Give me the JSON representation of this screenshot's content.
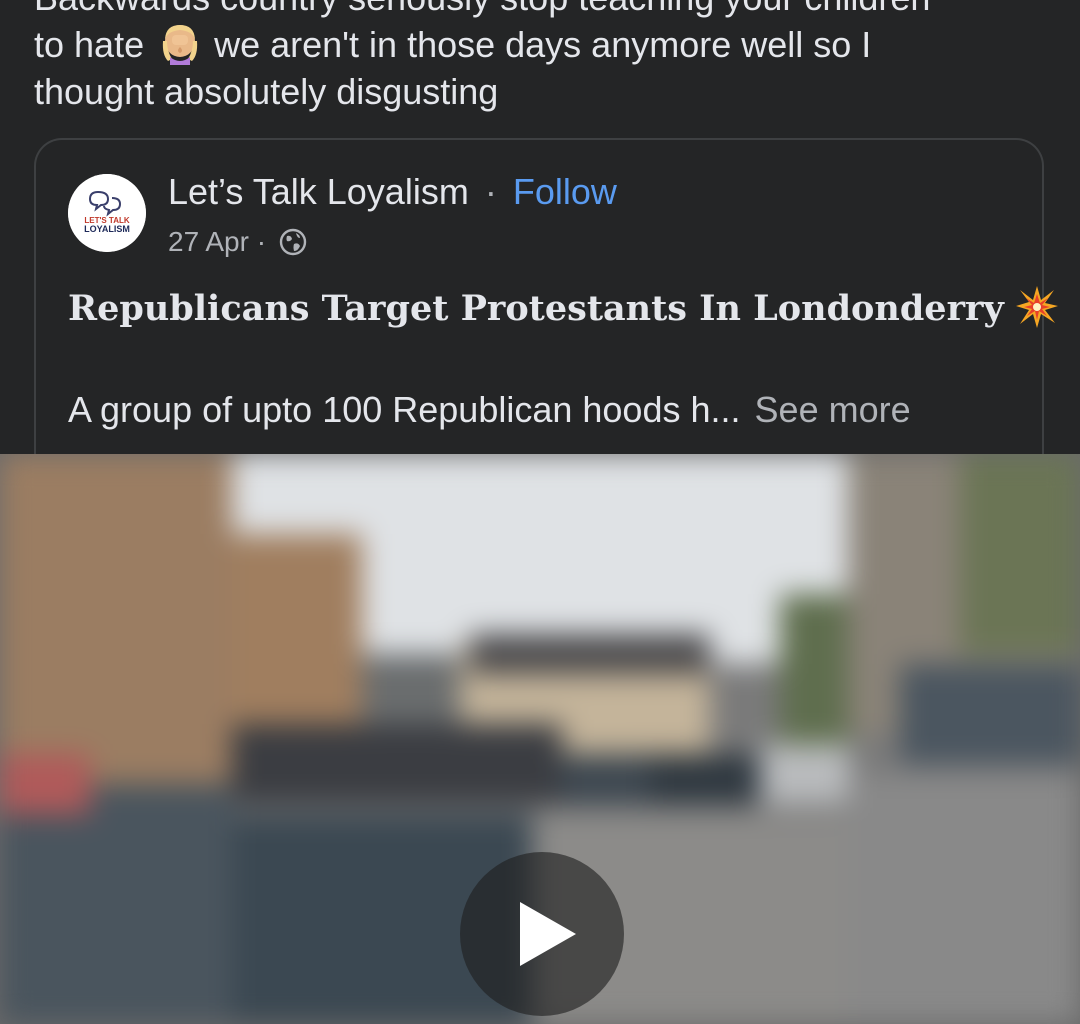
{
  "post": {
    "text_line1": "Backwards country seriously stop teaching your children",
    "text_line2_a": "to hate",
    "text_line2_b": "we aren't in those days anymore well so I",
    "text_line3": "thought absolutely disgusting",
    "emoji": "facepalm-emoji"
  },
  "shared_post": {
    "page_name": "Let’s Talk Loyalism",
    "separator": "·",
    "follow_label": "Follow",
    "date": "27 Apr",
    "meta_separator": "·",
    "privacy_icon": "globe-icon",
    "avatar_text_line1": "LET'S TALK",
    "avatar_text_line2": "LOYALISM",
    "headline": "Republicans Target Protestants In Londonderry",
    "headline_emoji": "collision-emoji",
    "excerpt": "A group of upto 100 Republican hoods h...",
    "see_more_label": "See more"
  },
  "video": {
    "play_icon": "play-icon"
  },
  "colors": {
    "background": "#242526",
    "text": "#e4e6eb",
    "secondary_text": "#b0b3b8",
    "link": "#5a9bf0",
    "border": "#3e4042"
  }
}
